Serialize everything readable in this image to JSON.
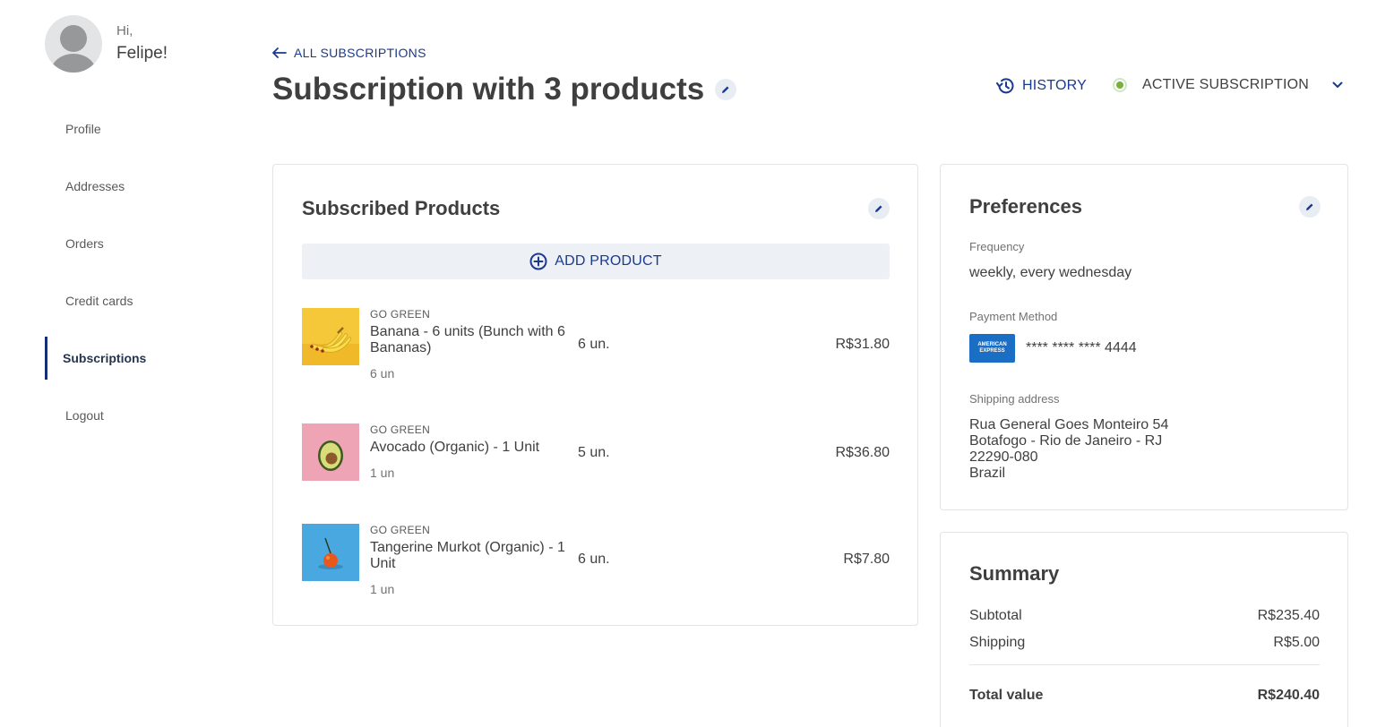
{
  "user": {
    "greeting": "Hi,",
    "name": "Felipe!"
  },
  "nav": [
    {
      "label": "Profile"
    },
    {
      "label": "Addresses"
    },
    {
      "label": "Orders"
    },
    {
      "label": "Credit cards"
    },
    {
      "label": "Subscriptions",
      "active": true
    },
    {
      "label": "Logout"
    }
  ],
  "header": {
    "back_label": "ALL SUBSCRIPTIONS",
    "title": "Subscription with 3 products",
    "history_label": "HISTORY",
    "status_label": "ACTIVE SUBSCRIPTION"
  },
  "products": {
    "title": "Subscribed Products",
    "add_label": "ADD PRODUCT",
    "items": [
      {
        "brand": "GO GREEN",
        "name": "Banana - 6 units (Bunch with 6 Bananas)",
        "unit": "6 un",
        "qty": "6 un.",
        "price": "R$31.80",
        "image": "banana"
      },
      {
        "brand": "GO GREEN",
        "name": "Avocado (Organic) - 1 Unit",
        "unit": "1 un",
        "qty": "5 un.",
        "price": "R$36.80",
        "image": "avocado"
      },
      {
        "brand": "GO GREEN",
        "name": "Tangerine Murkot (Organic) - 1 Unit",
        "unit": "1 un",
        "qty": "6 un.",
        "price": "R$7.80",
        "image": "tangerine"
      }
    ]
  },
  "preferences": {
    "title": "Preferences",
    "frequency_label": "Frequency",
    "frequency_value": "weekly, every wednesday",
    "payment_label": "Payment Method",
    "card_brand_line1": "AMERICAN",
    "card_brand_line2": "EXPRESS",
    "card_number": "**** **** **** 4444",
    "shipping_label": "Shipping address",
    "address_line1": "Rua General Goes Monteiro 54",
    "address_line2": "Botafogo - Rio de Janeiro - RJ",
    "address_line3": "22290-080",
    "address_line4": "Brazil"
  },
  "summary": {
    "title": "Summary",
    "subtotal_label": "Subtotal",
    "subtotal_value": "R$235.40",
    "shipping_label": "Shipping",
    "shipping_value": "R$5.00",
    "total_label": "Total value",
    "total_value": "R$240.40"
  },
  "colors": {
    "accent": "#1a3a8f",
    "status_green": "#79b03a",
    "amex_blue": "#1a6fc4",
    "add_button_bg": "#edf0f4"
  },
  "icons": [
    "arrow-left-icon",
    "pencil-icon",
    "history-icon",
    "status-dot-icon",
    "chevron-down-icon",
    "plus-circle-icon"
  ]
}
